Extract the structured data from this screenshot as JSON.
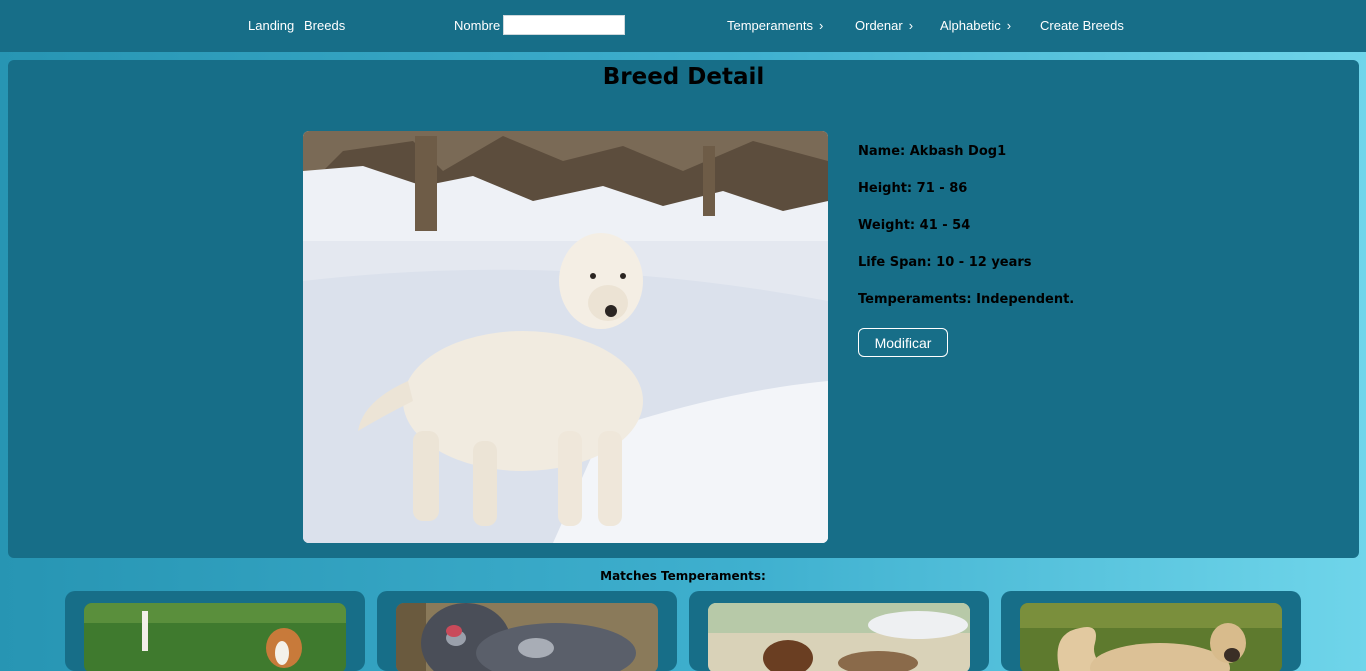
{
  "nav": {
    "landing": "Landing",
    "breeds": "Breeds",
    "search_label": "Nombre",
    "search_value": "",
    "temperaments": "Temperaments",
    "ordenar": "Ordenar",
    "alphabetic": "Alphabetic",
    "create": "Create Breeds",
    "chevron": "›"
  },
  "detail": {
    "title": "Breed Detail",
    "name": "Name: Akbash Dog1",
    "height": "Height: 71 - 86",
    "weight": "Weight: 41 - 54",
    "life_span": "Life Span: 10 - 12 years",
    "temperaments": "Temperaments: Independent.",
    "modify_button": "Modificar"
  },
  "matches": {
    "heading": "Matches Temperaments:",
    "cards": [
      {
        "image": "beagle-like dog on grass"
      },
      {
        "image": "merle dog with tongue out"
      },
      {
        "image": "brown dog outdoors"
      },
      {
        "image": "tan dog on grass"
      }
    ]
  },
  "colors": {
    "nav_bg": "#176e88",
    "panel_bg": "#176e88",
    "accent": "#6fd5ea"
  }
}
